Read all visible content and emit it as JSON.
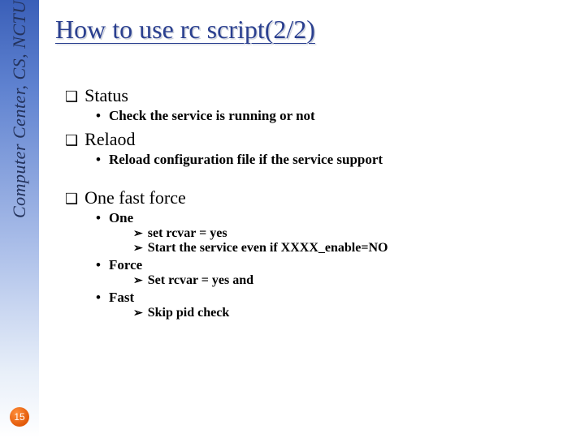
{
  "sidebar": {
    "label": "Computer Center, CS, NCTU",
    "slide_number": "15"
  },
  "title": "How to use rc script(2/2)",
  "sections": {
    "status": {
      "heading": "Status",
      "b1": "Check the service is running or not"
    },
    "reload": {
      "heading": "Relaod",
      "b1": "Reload configuration file if the service support"
    },
    "onefastforce": {
      "heading": "One fast force",
      "one_label": "One",
      "one_s1": "set rcvar = yes",
      "one_s2": "Start the service even if XXXX_enable=NO",
      "force_label": "Force",
      "force_s1": "Set rcvar = yes and",
      "fast_label": "Fast",
      "fast_s1": "Skip pid check"
    }
  },
  "glyphs": {
    "square": "❑",
    "bullet": "•",
    "triangle": "➢"
  }
}
